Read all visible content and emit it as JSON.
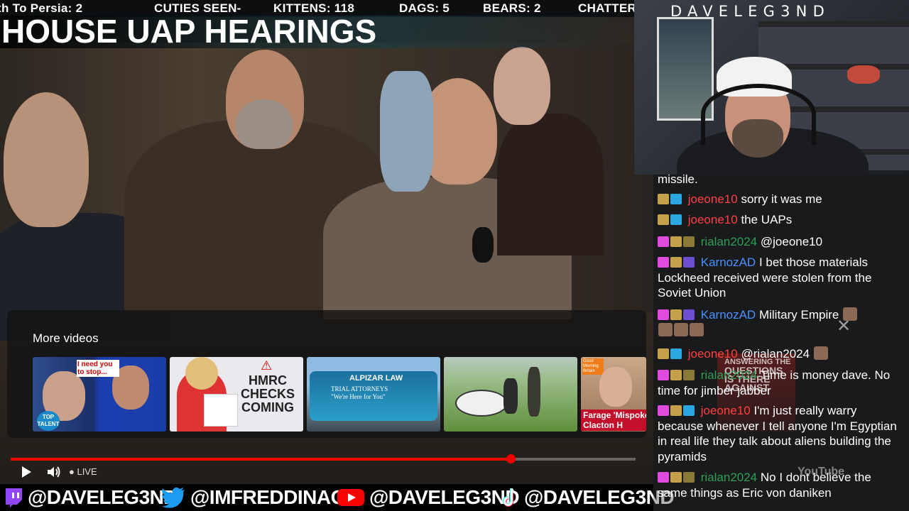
{
  "ticker": {
    "items": [
      "th To Persia: 2",
      "CUTIES SEEN-",
      "KITTENS: 118",
      "DAGS: 5",
      "BEARS: 2",
      "CHATTER"
    ]
  },
  "title": "HOUSE UAP HEARINGS",
  "more_videos": {
    "heading": "More videos",
    "thumbs": [
      {
        "caption": "I need you to stop...",
        "badge": "TOP TALENT"
      },
      {
        "caption": "HMRC CHECKS COMING"
      },
      {
        "caption": "TRIAL ATTORNEYS \"We're Here for You\"",
        "brand": "ALPIZAR LAW"
      },
      {
        "caption": ""
      },
      {
        "caption": "Farage 'Mispoke' About Clacton H",
        "brand": "Good Morning Britain"
      }
    ],
    "close_icon": "✕"
  },
  "player": {
    "progress": 0.8,
    "live_label": "LIVE"
  },
  "social": {
    "twitch": "@DAVELEG3ND",
    "twitter": "@IMFREDDINAGE",
    "youtube": "@DAVELEG3ND",
    "tiktok": "@DAVELEG3ND",
    "colors": {
      "twitch": "#9146ff",
      "twitter": "#1d9bf0",
      "youtube": "#ff0000"
    }
  },
  "streamer": "DAVELEG3ND",
  "chat": {
    "colors": {
      "red": "#ff4040",
      "green": "#2e9f58",
      "blue": "#4a90ff"
    },
    "messages": [
      {
        "user": "",
        "text": "missile.",
        "color": "red"
      },
      {
        "user": "joeone10",
        "text": "sorry it was me",
        "color": "red"
      },
      {
        "user": "joeone10",
        "text": "the UAPs",
        "color": "red"
      },
      {
        "user": "rialan2024",
        "text": "@joeone10",
        "color": "green"
      },
      {
        "user": "KarnozAD",
        "text": "I bet those materials Lockheed received were stolen from the Soviet Union",
        "color": "blue"
      },
      {
        "user": "KarnozAD",
        "text": "Military Empire",
        "color": "blue"
      },
      {
        "user": "joeone10",
        "text": "@rialan2024",
        "color": "red"
      },
      {
        "user": "rialan2024",
        "text": "Time is money dave. No time for jimber jabber",
        "color": "green"
      },
      {
        "user": "joeone10",
        "text": "I'm just really warry because whenever I tell anyone I'm Egyptian in real life they talk about aliens building the pyramids",
        "color": "red"
      },
      {
        "user": "rialan2024",
        "text": "No I dont believe the same things as Eric von daniken",
        "color": "green"
      }
    ],
    "overlay_texts": {
      "answering": "ANSWERING THE",
      "questions": "QUESTIONS",
      "is_there": "IS THERE",
      "against": "AGAINST",
      "youtube": "YouTube"
    }
  }
}
